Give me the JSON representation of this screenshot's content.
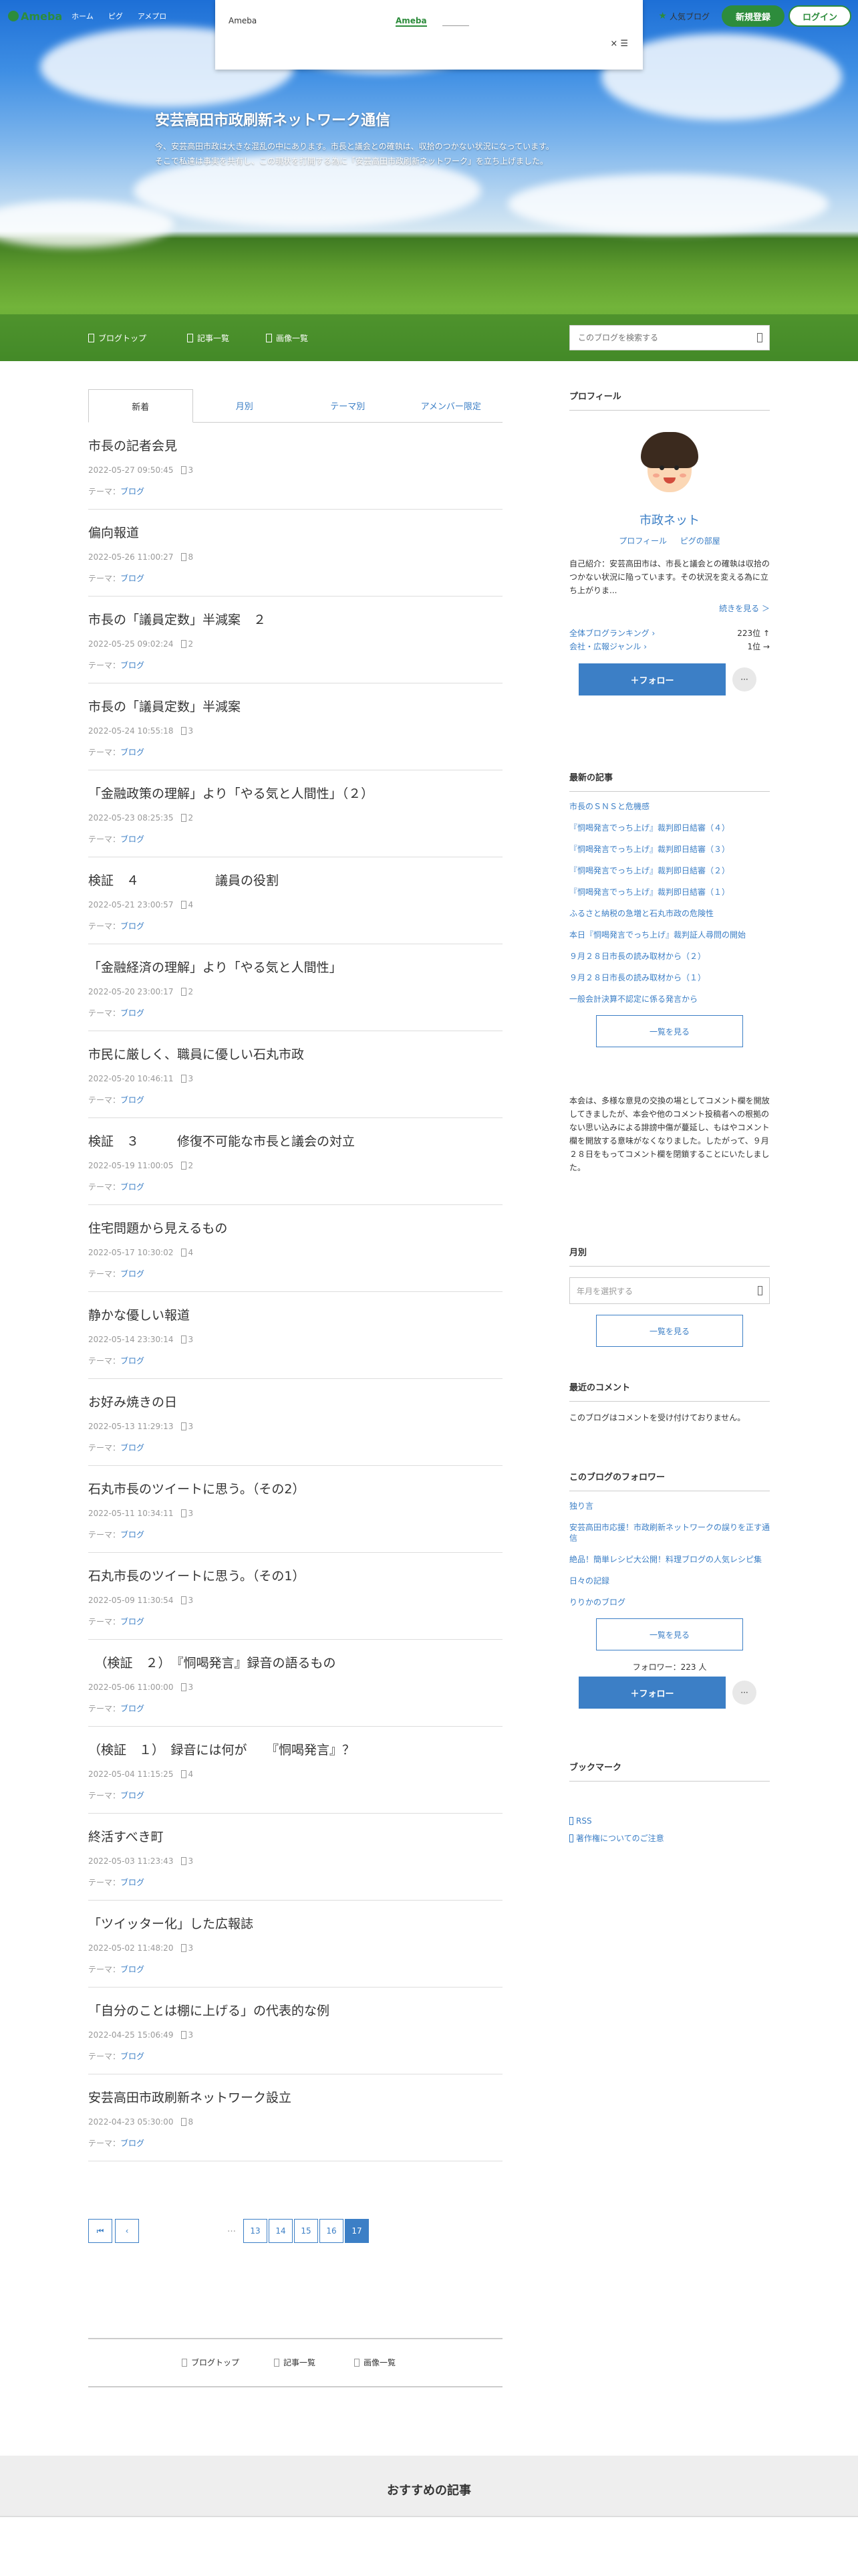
{
  "global_header": {
    "logo": "Ameba",
    "nav": [
      "ホーム",
      "ピグ",
      "アメプロ"
    ],
    "popular": "人気ブログ",
    "register": "新規登録",
    "login": "ログイン"
  },
  "ad_popup": {
    "label": "Ameba",
    "link": "Ameba",
    "close": "× ☰"
  },
  "hero": {
    "title": "安芸高田市政刷新ネットワーク通信",
    "desc_line1": "今、安芸高田市政は大きな混乱の中にあります。市長と議会との確執は、収拾のつかない状況になっています。",
    "desc_line2": "そこで私達は事実を共有し、この現状を打開する為に「安芸高田市政刷新ネットワーク」を立ち上げました。"
  },
  "subnav": {
    "top": "ブログトップ",
    "entries": "記事一覧",
    "images": "画像一覧",
    "search_placeholder": "このブログを検索する"
  },
  "tabs": [
    "新着",
    "月別",
    "テーマ別",
    "アメンバー限定"
  ],
  "theme_label": "テーマ：",
  "entries": [
    {
      "title": "市長の記者会見",
      "date": "2022-05-27 09:50:45",
      "comments": "3",
      "theme": "ブログ"
    },
    {
      "title": "偏向報道",
      "date": "2022-05-26 11:00:27",
      "comments": "8",
      "theme": "ブログ"
    },
    {
      "title": "市長の「議員定数」半減案　２",
      "date": "2022-05-25 09:02:24",
      "comments": "2",
      "theme": "ブログ"
    },
    {
      "title": "市長の「議員定数」半減案",
      "date": "2022-05-24 10:55:18",
      "comments": "3",
      "theme": "ブログ"
    },
    {
      "title": "「金融政策の理解」より「やる気と人間性」（２）",
      "date": "2022-05-23 08:25:35",
      "comments": "2",
      "theme": "ブログ"
    },
    {
      "title": "検証　４　　　　　　議員の役割",
      "date": "2022-05-21 23:00:57",
      "comments": "4",
      "theme": "ブログ"
    },
    {
      "title": "「金融経済の理解」より「やる気と人間性」",
      "date": "2022-05-20 23:00:17",
      "comments": "2",
      "theme": "ブログ"
    },
    {
      "title": "市民に厳しく、職員に優しい石丸市政",
      "date": "2022-05-20 10:46:11",
      "comments": "3",
      "theme": "ブログ"
    },
    {
      "title": "検証　３　　　修復不可能な市長と議会の対立",
      "date": "2022-05-19 11:00:05",
      "comments": "2",
      "theme": "ブログ"
    },
    {
      "title": "住宅問題から見えるもの",
      "date": "2022-05-17 10:30:02",
      "comments": "4",
      "theme": "ブログ"
    },
    {
      "title": "静かな優しい報道",
      "date": "2022-05-14 23:30:14",
      "comments": "3",
      "theme": "ブログ"
    },
    {
      "title": "お好み焼きの日",
      "date": "2022-05-13 11:29:13",
      "comments": "3",
      "theme": "ブログ"
    },
    {
      "title": "石丸市長のツイートに思う。（その2）",
      "date": "2022-05-11 10:34:11",
      "comments": "3",
      "theme": "ブログ"
    },
    {
      "title": "石丸市長のツイートに思う。（その1）",
      "date": "2022-05-09 11:30:54",
      "comments": "3",
      "theme": "ブログ"
    },
    {
      "title": "　（検証　２）　『恫喝発言』録音の語るもの",
      "date": "2022-05-06 11:00:00",
      "comments": "3",
      "theme": "ブログ"
    },
    {
      "title": "（検証　１）　録音には何が　　『恫喝発言』？",
      "date": "2022-05-04 11:15:25",
      "comments": "4",
      "theme": "ブログ"
    },
    {
      "title": "終活すべき町",
      "date": "2022-05-03 11:23:43",
      "comments": "3",
      "theme": "ブログ"
    },
    {
      "title": "「ツイッター化」した広報誌",
      "date": "2022-05-02 11:48:20",
      "comments": "3",
      "theme": "ブログ"
    },
    {
      "title": "「自分のことは棚に上げる」の代表的な例",
      "date": "2022-04-25 15:06:49",
      "comments": "3",
      "theme": "ブログ"
    },
    {
      "title": "安芸高田市政刷新ネットワーク設立",
      "date": "2022-04-23 05:30:00",
      "comments": "8",
      "theme": "ブログ"
    }
  ],
  "pager": {
    "dots": "…",
    "pages": [
      "13",
      "14",
      "15",
      "16",
      "17"
    ],
    "current": "17"
  },
  "footnav": {
    "top": "ブログトップ",
    "entries": "記事一覧",
    "images": "画像一覧"
  },
  "recommend_title": "おすすめの記事",
  "profile": {
    "heading": "プロフィール",
    "name": "市政ネット",
    "link_profile": "プロフィール",
    "link_room": "ピグの部屋",
    "intro": "自己紹介：安芸高田市は、市長と議会との確執は収拾のつかない状況に陥っています。その状況を変える為に立ち上がりま...",
    "more": "続きを見る ＞",
    "rank1_label": "全体ブログランキング ›",
    "rank1_val": "223位 ↑",
    "rank2_label": "会社・広報ジャンル ›",
    "rank2_val": "1位 →",
    "follow": "＋フォロー",
    "dots": "···"
  },
  "latest": {
    "heading": "最新の記事",
    "items": [
      "市長のＳＮＳと危機感",
      "『恫喝発言でっち上げ』裁判即日結審（４）",
      "『恫喝発言でっち上げ』裁判即日結審（３）",
      "『恫喝発言でっち上げ』裁判即日結審（２）",
      "『恫喝発言でっち上げ』裁判即日結審（１）",
      "ふるさと納税の急増と石丸市政の危険性",
      "本日『恫喝発言でっち上げ』裁判証人尋問の開始",
      "９月２８日市長の読み取材から（２）",
      "９月２８日市長の読み取材から（１）",
      "一般会計決算不認定に係る発言から"
    ],
    "list_button": "一覧を見る"
  },
  "notice": "本会は、多様な意見の交換の場としてコメント欄を開放してきましたが、本会や他のコメント投稿者への根拠のない思い込みによる誹謗中傷が蔓延し、もはやコメント欄を開放する意味がなくなりました。したがって、９月２８日をもってコメント欄を閉鎖することにいたしました。",
  "monthly": {
    "heading": "月別",
    "select_placeholder": "年月を選択する",
    "list_button": "一覧を見る"
  },
  "comments": {
    "heading": "最近のコメント",
    "text": "このブログはコメントを受け付けておりません。"
  },
  "followers": {
    "heading": "このブログのフォロワー",
    "items": [
      "独り言",
      "安芸高田市応援！市政刷新ネットワークの誤りを正す通信",
      "絶品！簡単レシピ大公開！料理ブログの人気レシピ集",
      "日々の記録",
      "りりかのブログ"
    ],
    "list_button": "一覧を見る",
    "count": "フォロワー：223 人",
    "follow": "＋フォロー",
    "dots": "···"
  },
  "bookmark": {
    "heading": "ブックマーク",
    "rss": "RSS",
    "copyright": "著作権についてのご注意"
  }
}
